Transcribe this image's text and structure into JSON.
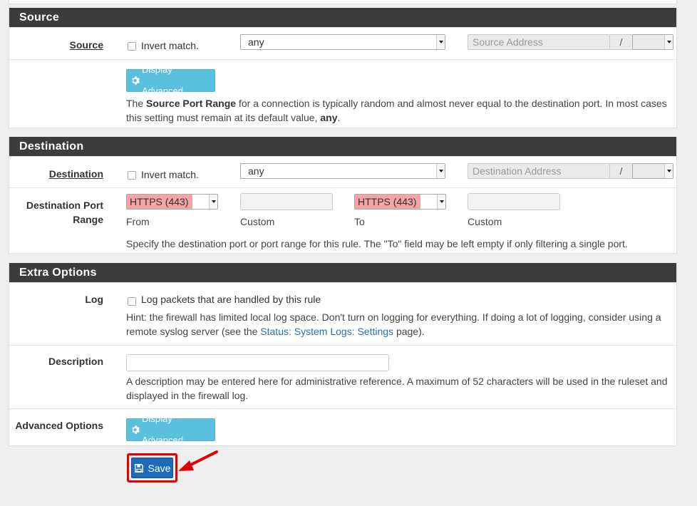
{
  "source": {
    "heading": "Source",
    "label": "Source",
    "invert_label": "Invert match.",
    "type_value": "any",
    "address_placeholder": "Source Address",
    "slash": "/",
    "advanced_button": "Display Advanced",
    "help_pre": "The ",
    "help_bold": "Source Port Range",
    "help_mid": " for a connection is typically random and almost never equal to the destination port. In most cases this setting must remain at its default value, ",
    "help_any": "any",
    "help_end": "."
  },
  "destination": {
    "heading": "Destination",
    "label": "Destination",
    "invert_label": "Invert match.",
    "type_value": "any",
    "address_placeholder": "Destination Address",
    "slash": "/",
    "port_label_line1": "Destination Port",
    "port_label_line2": "Range",
    "from_value": "HTTPS (443)",
    "to_value": "HTTPS (443)",
    "from_caption": "From",
    "custom_caption_1": "Custom",
    "to_caption": "To",
    "custom_caption_2": "Custom",
    "help": "Specify the destination port or port range for this rule. The \"To\" field may be left empty if only filtering a single port."
  },
  "extra": {
    "heading": "Extra Options",
    "log_label": "Log",
    "log_checkbox_label": "Log packets that are handled by this rule",
    "log_hint_pre": "Hint: the firewall has limited local log space. Don't turn on logging for everything. If doing a lot of logging, consider using a remote syslog server (see the ",
    "log_hint_link": "Status: System Logs: Settings",
    "log_hint_post": " page).",
    "description_label": "Description",
    "description_value": "",
    "description_help": "A description may be entered here for administrative reference. A maximum of 52 characters will be used in the ruleset and displayed in the firewall log.",
    "advanced_label": "Advanced Options",
    "advanced_button": "Display Advanced"
  },
  "save_label": "Save",
  "colors": {
    "heading_bg": "#3c3c3c",
    "info_button": "#5bc0de",
    "primary_button": "#1e6bb8",
    "highlight": "#f5a3a3",
    "annotation": "#e00000"
  }
}
